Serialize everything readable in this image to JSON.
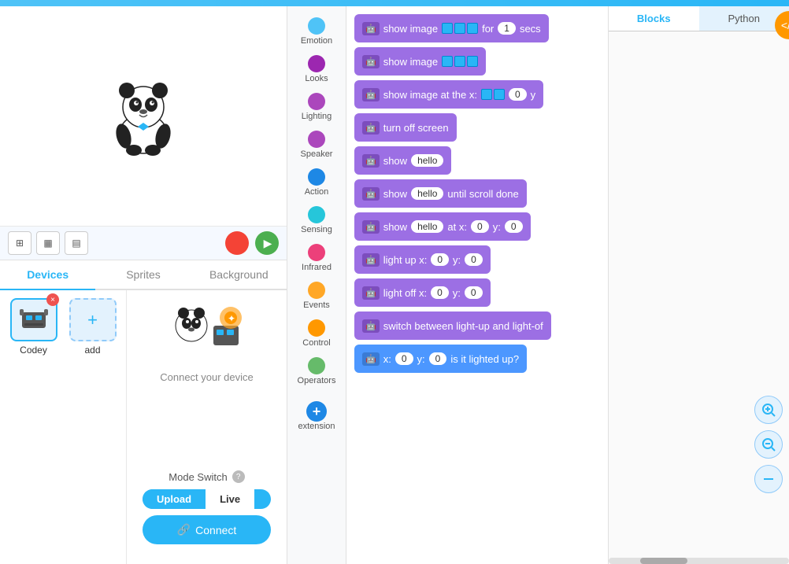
{
  "topbar": {
    "color": "#4fc3f7"
  },
  "preview": {
    "panda_emoji": "🐼"
  },
  "tabs": [
    {
      "id": "devices",
      "label": "Devices"
    },
    {
      "id": "sprites",
      "label": "Sprites"
    },
    {
      "id": "background",
      "label": "Background"
    }
  ],
  "active_tab": "devices",
  "toolbar": {
    "stop_color": "#f44336",
    "play_color": "#4caf50"
  },
  "device": {
    "name": "Codey",
    "connect_label": "Connect your device",
    "add_label": "add"
  },
  "mode_switch": {
    "label": "Mode Switch",
    "upload": "Upload",
    "live": "Live",
    "connect": "Connect"
  },
  "categories": [
    {
      "id": "emotion",
      "label": "Emotion",
      "color": "#4fc3f7"
    },
    {
      "id": "looks",
      "label": "Looks",
      "color": "#9c27b0"
    },
    {
      "id": "lighting",
      "label": "Lighting",
      "color": "#ab47bc"
    },
    {
      "id": "speaker",
      "label": "Speaker",
      "color": "#ab47bc"
    },
    {
      "id": "action",
      "label": "Action",
      "color": "#1e88e5"
    },
    {
      "id": "sensing",
      "label": "Sensing",
      "color": "#26c6da"
    },
    {
      "id": "infrared",
      "label": "Infrared",
      "color": "#ec407a"
    },
    {
      "id": "events",
      "label": "Events",
      "color": "#ffa726"
    },
    {
      "id": "control",
      "label": "Control",
      "color": "#ff9800"
    },
    {
      "id": "operators",
      "label": "Operators",
      "color": "#66bb6a"
    },
    {
      "id": "extension",
      "label": "extension",
      "color": "#1e88e5"
    }
  ],
  "blocks": [
    {
      "id": "b1",
      "text": "show image",
      "suffix": "for",
      "val1": "1",
      "val2": "secs",
      "has_img": true
    },
    {
      "id": "b2",
      "text": "show image",
      "has_img": true
    },
    {
      "id": "b3",
      "text": "show image at the x:",
      "val1": "0",
      "val2": "y",
      "has_img": true
    },
    {
      "id": "b4",
      "text": "turn off screen"
    },
    {
      "id": "b5",
      "text": "show",
      "val1": "hello"
    },
    {
      "id": "b6",
      "text": "show",
      "val1": "hello",
      "suffix": "until scroll done"
    },
    {
      "id": "b7",
      "text": "show",
      "val1": "hello",
      "suffix": "at x:",
      "val2": "0",
      "val3": "y:",
      "val4": "0"
    },
    {
      "id": "b8",
      "text": "light up x:",
      "val1": "0",
      "suffix": "y:",
      "val2": "0"
    },
    {
      "id": "b9",
      "text": "light off x:",
      "val1": "0",
      "suffix": "y:",
      "val2": "0"
    },
    {
      "id": "b10",
      "text": "switch between light-up and light-of"
    },
    {
      "id": "b11",
      "text": "x:",
      "val1": "0",
      "suffix": "y:",
      "val2": "0",
      "suffix2": "is it lighted up?"
    }
  ],
  "code_tabs": [
    {
      "id": "blocks",
      "label": "Blocks"
    },
    {
      "id": "python",
      "label": "Python"
    }
  ],
  "float_buttons": [
    {
      "id": "zoom-in",
      "symbol": "🔍"
    },
    {
      "id": "zoom-out",
      "symbol": "🔍"
    },
    {
      "id": "reset",
      "symbol": "—"
    }
  ],
  "scrollbar_label": "horizontal-scrollbar"
}
